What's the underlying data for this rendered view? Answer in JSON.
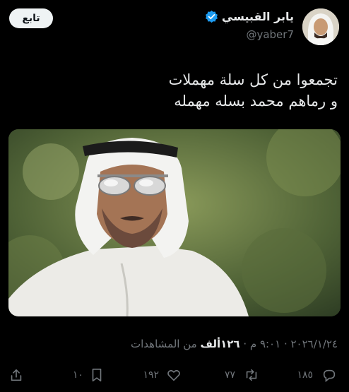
{
  "header": {
    "follow_label": "تابع",
    "display_name": "يابر القبيسي",
    "handle": "@yaber7"
  },
  "tweet": {
    "lines": [
      "تجمعوا من كل سلة مهملات",
      "و رماهم محمد بسله مهمله"
    ]
  },
  "meta": {
    "date": "٢٠٢٦/١/٢٤",
    "separator1": " · ",
    "time": "٩:٠١ م",
    "separator2": " · ",
    "views_count": "١٢٦ألف",
    "views_label": " من المشاهدات"
  },
  "actions": {
    "reply_count": "١٨٥",
    "retweet_count": "٧٧",
    "like_count": "١٩٢",
    "bookmark_count": "١٠"
  },
  "icons": [
    "verified-badge-icon",
    "reply-icon",
    "retweet-icon",
    "like-icon",
    "bookmark-icon",
    "share-icon"
  ],
  "colors": {
    "verified": "#1d9bf0",
    "muted": "#71767b",
    "text": "#e7e9ea"
  }
}
